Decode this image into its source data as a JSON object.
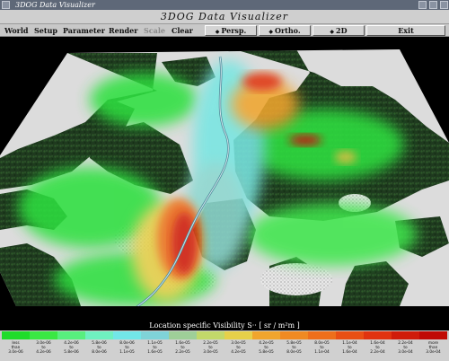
{
  "window": {
    "title": "3DOG Data Visualizer"
  },
  "app": {
    "title": "3DOG Data Visualizer"
  },
  "menu": {
    "items": [
      "World",
      "Setup",
      "Parameter",
      "Render",
      "Scale",
      "Clear"
    ],
    "disabled_item": "Scale"
  },
  "toolbar": {
    "perspective_label": "Persp.",
    "ortho_label": "Ortho.",
    "twod_label": "2D",
    "exit_label": "Exit"
  },
  "legend": {
    "title": "Location specific Visibility S··  [ sr / m²m ]",
    "colors": [
      "#1fdc2a",
      "#3ae843",
      "#58ef7e",
      "#6ff0c0",
      "#72e6e8",
      "#7fd3d8",
      "#9ecf98",
      "#c2d86a",
      "#e6d04a",
      "#f0a52d",
      "#f08a22",
      "#ee6f1b",
      "#e94f14",
      "#e0330f",
      "#d01c0a",
      "#c00a04"
    ],
    "ticks": [
      [
        "less",
        "than",
        "3.0e-06"
      ],
      [
        "3.0e-06",
        "to",
        "4.2e-06"
      ],
      [
        "4.2e-06",
        "to",
        "5.8e-06"
      ],
      [
        "5.8e-06",
        "to",
        "8.0e-06"
      ],
      [
        "8.0e-06",
        "to",
        "1.1e-05"
      ],
      [
        "1.1e-05",
        "to",
        "1.6e-05"
      ],
      [
        "1.6e-05",
        "to",
        "2.2e-05"
      ],
      [
        "2.2e-05",
        "to",
        "3.0e-05"
      ],
      [
        "3.0e-05",
        "to",
        "4.2e-05"
      ],
      [
        "4.2e-05",
        "to",
        "5.8e-05"
      ],
      [
        "5.8e-05",
        "to",
        "8.0e-05"
      ],
      [
        "8.0e-05",
        "to",
        "1.1e-04"
      ],
      [
        "1.1e-04",
        "to",
        "1.6e-04"
      ],
      [
        "1.6e-04",
        "to",
        "2.2e-04"
      ],
      [
        "2.2e-04",
        "to",
        "3.0e-04"
      ],
      [
        "more",
        "than",
        "3.0e-04"
      ]
    ]
  }
}
